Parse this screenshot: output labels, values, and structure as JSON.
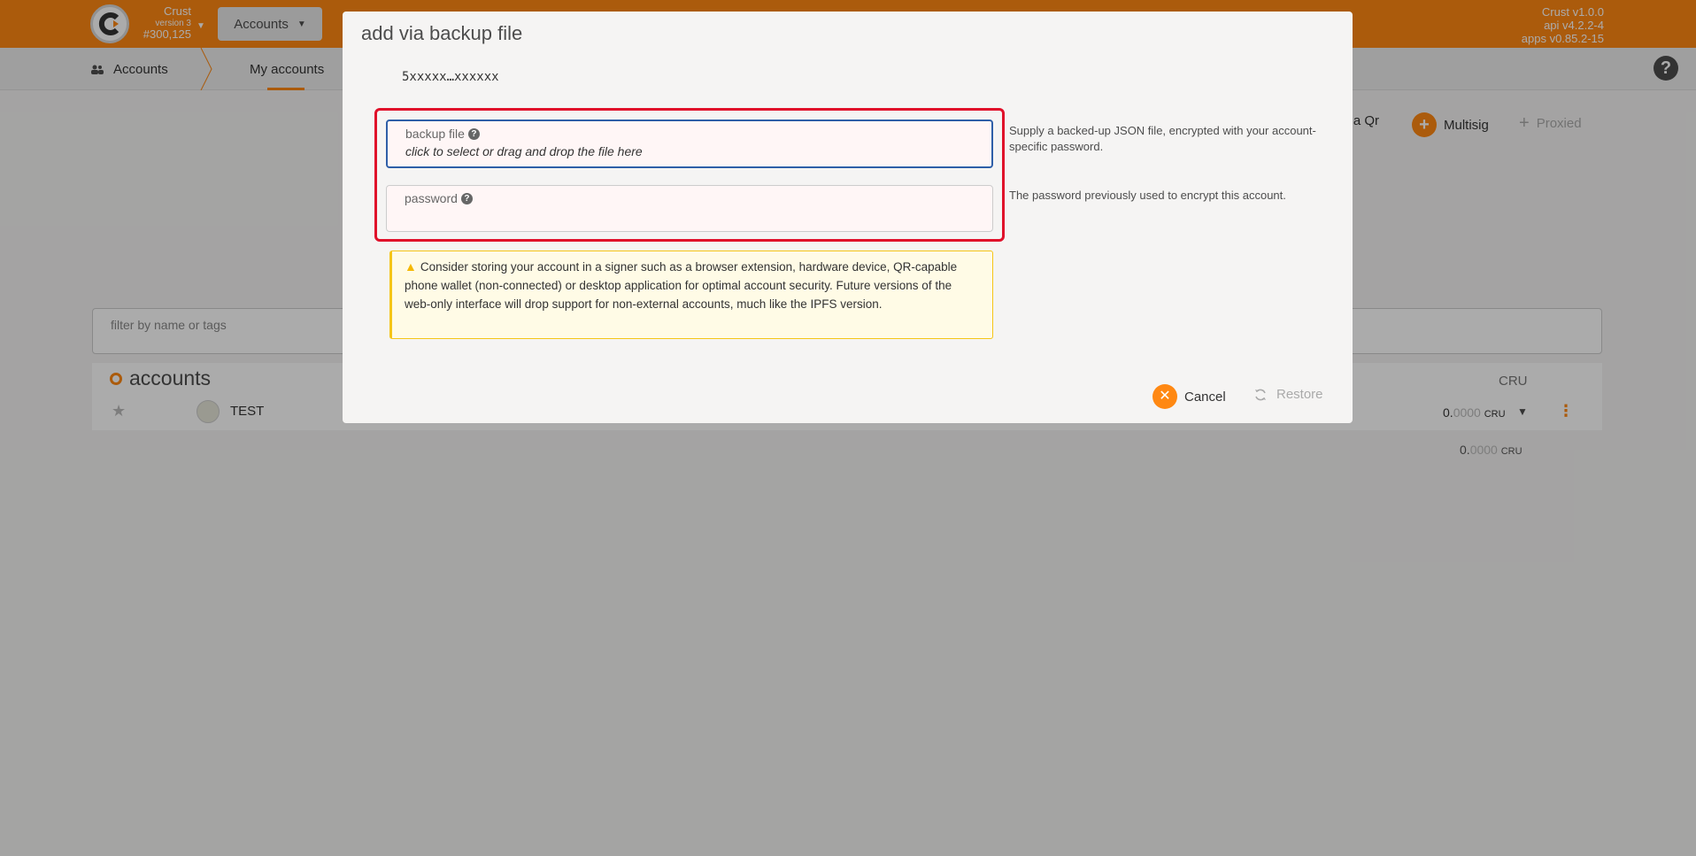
{
  "topbar": {
    "chain_name": "Crust",
    "chain_version": "version 3",
    "block_number": "#300,125",
    "menu_label": "Accounts",
    "versions": [
      "Crust v1.0.0",
      "api v4.2.2-4",
      "apps v0.85.2-15"
    ]
  },
  "subnav": {
    "section_label": "Accounts",
    "active_tab": "My accounts"
  },
  "page_actions": {
    "via_qr": "via Qr",
    "multisig": "Multisig",
    "proxied": "Proxied"
  },
  "filter": {
    "placeholder": "filter by name or tags"
  },
  "accounts_table": {
    "title": "accounts",
    "column_header": "CRU",
    "rows": [
      {
        "name": "TEST",
        "balance_int": "0.",
        "balance_dec": "0000",
        "unit": "CRU"
      }
    ],
    "total": {
      "balance_int": "0.",
      "balance_dec": "0000",
      "unit": "CRU"
    }
  },
  "modal": {
    "title": "add via backup file",
    "address": "5xxxxx…xxxxxx",
    "backup_field": {
      "label": "backup file",
      "value": "click to select or drag and drop the file here",
      "help": "Supply a backed-up JSON file, encrypted with your account-specific password."
    },
    "password_field": {
      "label": "password",
      "value": "",
      "help": "The password previously used to encrypt this account."
    },
    "warning": "Consider storing your account in a signer such as a browser extension, hardware device, QR-capable phone wallet (non-connected) or desktop application for optimal account security. Future versions of the web-only interface will drop support for non-external accounts, much like the IPFS version.",
    "cancel_label": "Cancel",
    "restore_label": "Restore"
  },
  "colors": {
    "brand": "#ff8812",
    "highlight": "#e0102a",
    "focus": "#2f5fa8",
    "warning": "#f5c518"
  }
}
